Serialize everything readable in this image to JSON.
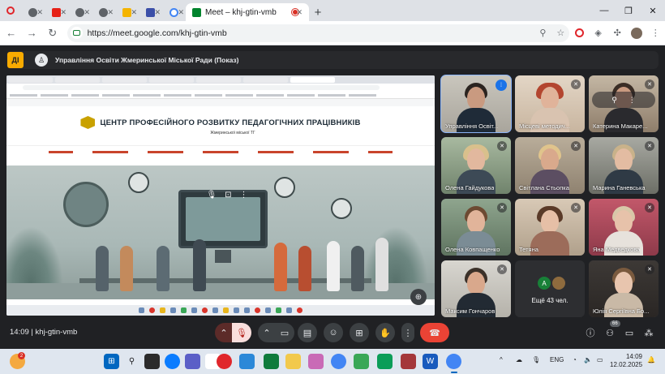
{
  "browser": {
    "active_tab_title": "Meet – khj-gtin-vmb",
    "url": "https://meet.google.com/khj-gtin-vmb",
    "new_tab_glyph": "+",
    "tab_close_glyph": "✕",
    "window_controls": [
      "—",
      "❐",
      "✕"
    ]
  },
  "meet": {
    "logo_letter": "ДІ",
    "presenter_title": "Управління Освіти Жмеринської Міської Ради (Показ)",
    "meeting_code": "khj-gtin-vmb",
    "time": "14:09",
    "people_badge": "66",
    "more_label": "Ещё 43 чел.",
    "more_avatar_letter": "A"
  },
  "shared_site": {
    "title": "ЦЕНТР ПРОФЕСІЙНОГО РОЗВИТКУ ПЕДАГОГІЧНИХ ПРАЦІВНИКІВ",
    "subtitle": "Жмеринської міської ТГ"
  },
  "participants": [
    {
      "name": "Управління Освіт...",
      "state": "speaking"
    },
    {
      "name": "Місцеві методич...",
      "state": "muted"
    },
    {
      "name": "Катерина Макаре...",
      "state": "muted"
    },
    {
      "name": "Олена Гайдукова",
      "state": "muted"
    },
    {
      "name": "Світлана Стьопка",
      "state": "muted"
    },
    {
      "name": "Марина Ганевська",
      "state": "muted"
    },
    {
      "name": "Олена Ковпащенко",
      "state": "muted"
    },
    {
      "name": "Тетяна",
      "state": "muted"
    },
    {
      "name": "Яна Медведкова",
      "state": "muted"
    },
    {
      "name": "Максим Гончаров",
      "state": "muted"
    },
    {
      "name": "Юлія Сергіївна Бо...",
      "state": "muted"
    }
  ],
  "taskbar": {
    "notif_count": "2",
    "lang": "ENG",
    "clock_time": "14:09",
    "clock_date": "12.02.2025"
  },
  "colors": {
    "meet_bg": "#202124",
    "leave_red": "#ea4335",
    "accent_blue": "#1a73e8",
    "logo_yellow": "#f9ab00"
  }
}
